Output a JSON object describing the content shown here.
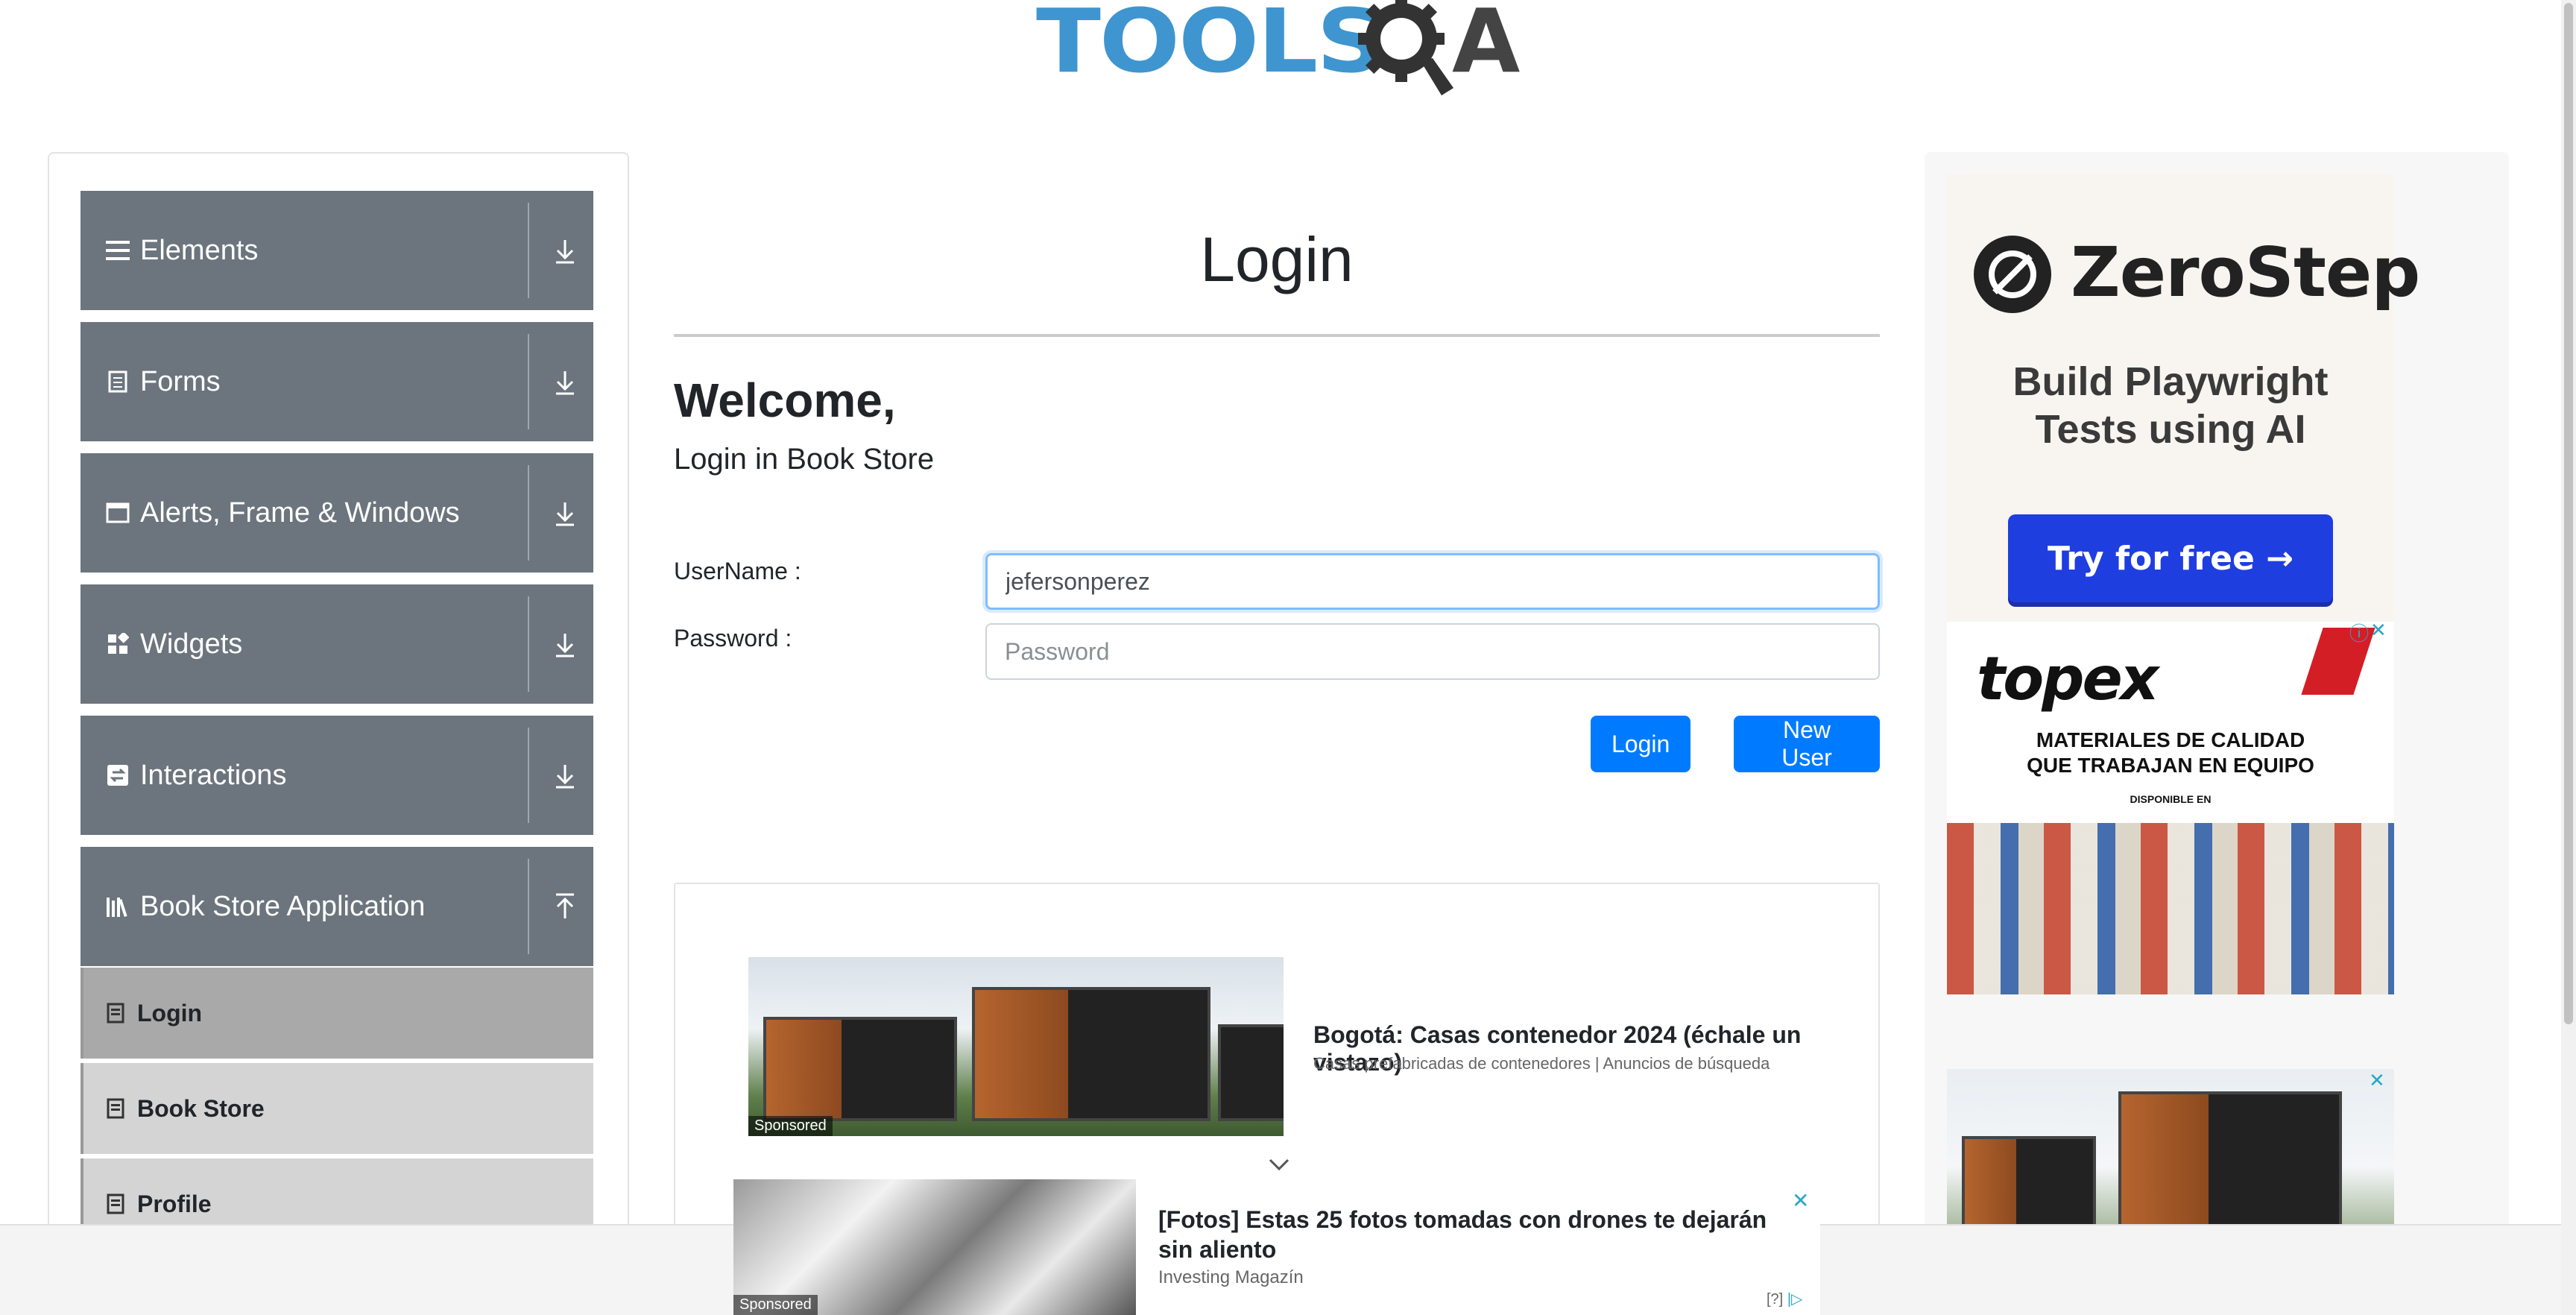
{
  "logo": {
    "text_part": "TOOLS",
    "text_a": "A"
  },
  "sidebar": {
    "groups": [
      {
        "label": "Elements",
        "icon": "list-icon",
        "expanded": false
      },
      {
        "label": "Forms",
        "icon": "document-icon",
        "expanded": false
      },
      {
        "label": "Alerts, Frame & Windows",
        "icon": "window-icon",
        "expanded": false
      },
      {
        "label": "Widgets",
        "icon": "widgets-icon",
        "expanded": false
      },
      {
        "label": "Interactions",
        "icon": "interactions-icon",
        "expanded": false
      },
      {
        "label": "Book Store Application",
        "icon": "books-icon",
        "expanded": true
      }
    ],
    "book_store_items": [
      {
        "label": "Login",
        "active": true
      },
      {
        "label": "Book Store",
        "active": false
      },
      {
        "label": "Profile",
        "active": false
      }
    ]
  },
  "main": {
    "title": "Login",
    "welcome": "Welcome,",
    "welcome_sub": "Login in Book Store",
    "username_label": "UserName :",
    "password_label": "Password :",
    "username_value": "jefersonperez",
    "password_placeholder": "Password",
    "login_button": "Login",
    "new_user_button": "New User"
  },
  "ads": {
    "main_ad": {
      "title": "Bogotá: Casas contenedor 2024 (échale un vistazo)",
      "subtitle": "Casas prefabricadas de contenedores | Anuncios de búsqueda",
      "sponsored": "Sponsored"
    },
    "bottom_ad": {
      "title": "[Fotos] Estas 25 fotos tomadas con drones te dejarán sin aliento",
      "subtitle": "Investing Magazín",
      "sponsored": "Sponsored",
      "choices": "[?]"
    },
    "zerostep": {
      "name": "ZeroStep",
      "tagline_1": "Build Playwright",
      "tagline_2": "Tests using AI",
      "button": "Try for free →"
    },
    "topex": {
      "logo": "topex",
      "line_1": "MATERIALES DE CALIDAD",
      "line_2": "QUE TRABAJAN EN EQUIPO",
      "available": "DISPONIBLE EN"
    }
  },
  "colors": {
    "primary": "#007bff",
    "sidebar_group": "#6c757d",
    "submenu": "#d4d4d4",
    "submenu_active": "#a9a9a9",
    "logo_blue": "#3f95cf"
  }
}
